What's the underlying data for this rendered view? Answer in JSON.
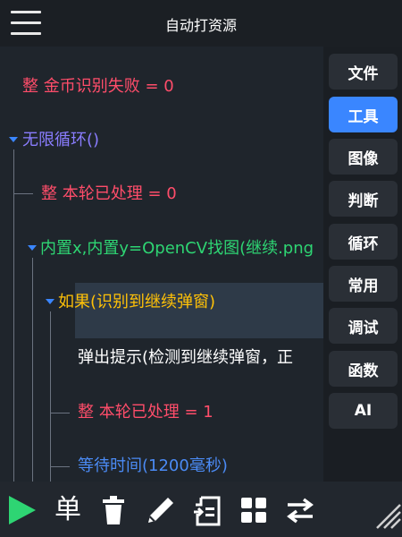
{
  "header": {
    "title": "自动打资源"
  },
  "editor": {
    "lines": [
      {
        "text": "整 金币识别失败 = 0",
        "color": "#ff4d6a"
      },
      {
        "text": "无限循环()",
        "color": "#8a7dff"
      },
      {
        "text": "整 本轮已处理 = 0",
        "color": "#ff4d6a"
      },
      {
        "text": "内置x,内置y=OpenCV找图(继续.png",
        "color": "#2ed573"
      },
      {
        "text": "如果(识别到继续弹窗)",
        "color": "#ffc107"
      },
      {
        "text": "弹出提示(检测到继续弹窗，正",
        "color": "#ffffff"
      },
      {
        "text": "整 本轮已处理 = 1",
        "color": "#ff4d6a"
      },
      {
        "text": "等待时间(1200毫秒)",
        "color": "#4b8bf5"
      }
    ]
  },
  "sidebar": {
    "active_color": "#3a86ff",
    "items": [
      {
        "label": "文件"
      },
      {
        "label": "工具",
        "active": true
      },
      {
        "label": "图像"
      },
      {
        "label": "判断"
      },
      {
        "label": "循环"
      },
      {
        "label": "常用"
      },
      {
        "label": "调试"
      },
      {
        "label": "函数"
      },
      {
        "label": "AI"
      }
    ]
  },
  "toolbar": {
    "single_label": "单",
    "icons": [
      "play-icon",
      "delete-icon",
      "edit-icon",
      "paste-icon",
      "grid-icon",
      "swap-icon",
      "resize-icon"
    ]
  }
}
